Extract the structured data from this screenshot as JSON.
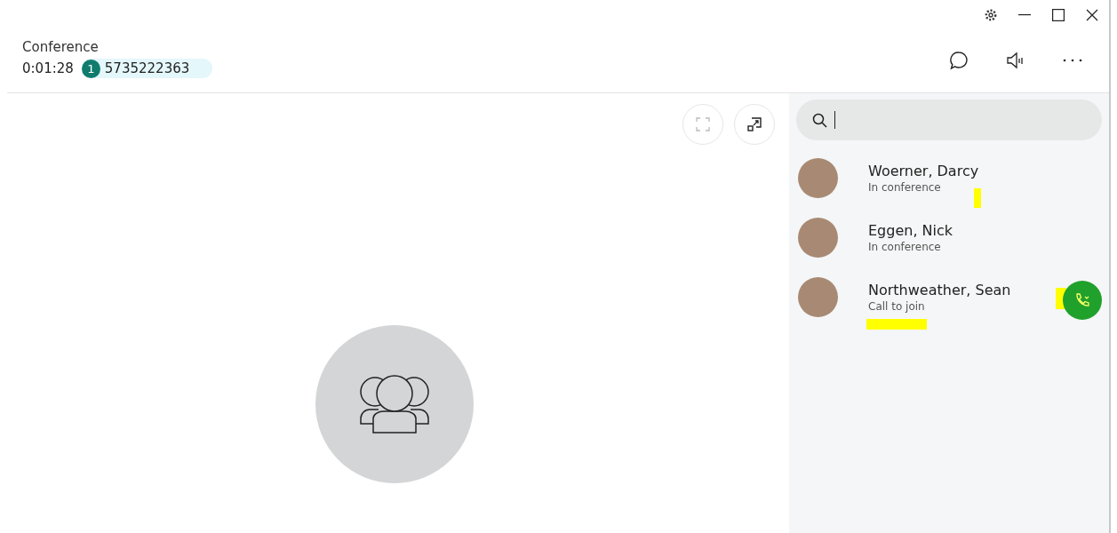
{
  "window": {
    "title": "Conference"
  },
  "call": {
    "duration": "0:01:28",
    "participant_count": "1",
    "number": "5735222363"
  },
  "contacts": [
    {
      "name": "Woerner, Darcy",
      "status": "In conference",
      "joinable": false
    },
    {
      "name": "Eggen, Nick",
      "status": "In conference",
      "joinable": false
    },
    {
      "name": "Northweather, Sean",
      "status": "Call to join",
      "joinable": true
    }
  ]
}
